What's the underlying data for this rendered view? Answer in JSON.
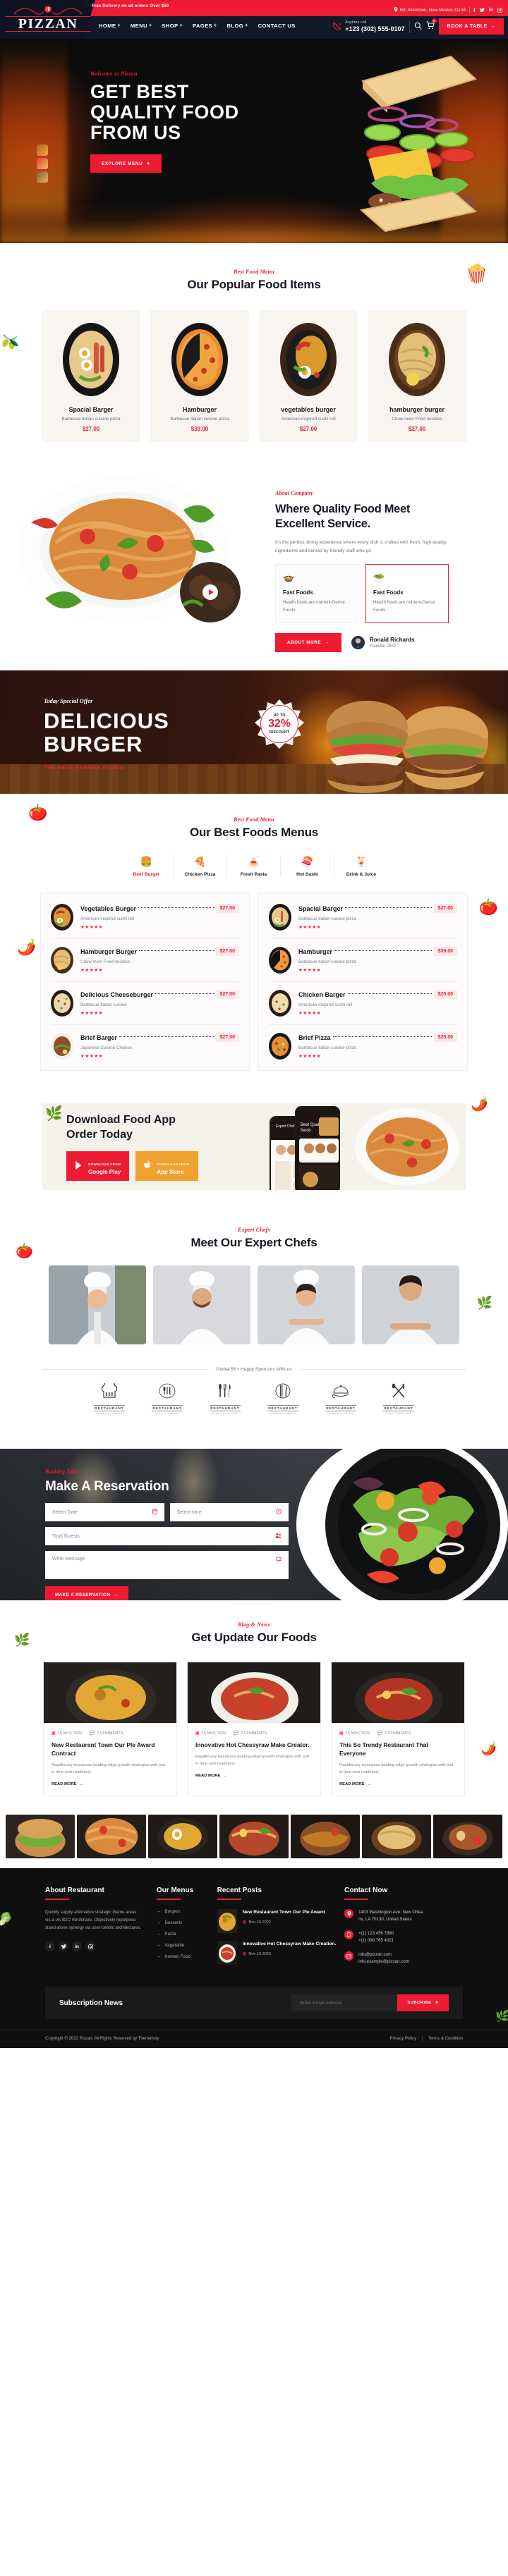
{
  "header": {
    "topbar_promo": "Free Delivery on all orders Over $50",
    "address": "Rd. Allentown, New Mexico 31134",
    "address_icon": "location-pin-icon",
    "socials": [
      "facebook-icon",
      "twitter-icon",
      "linkedin-icon",
      "instagram-icon"
    ],
    "logo_text": "PIZZAN",
    "nav": [
      {
        "label": "HOME",
        "has_dropdown": true
      },
      {
        "label": "MENU",
        "has_dropdown": true
      },
      {
        "label": "SHOP",
        "has_dropdown": true
      },
      {
        "label": "PAGES",
        "has_dropdown": true
      },
      {
        "label": "BLOG",
        "has_dropdown": true
      },
      {
        "label": "CONTACT US",
        "has_dropdown": false
      }
    ],
    "call_label": "Anytime call",
    "phone": "+123 (302) 555-0107",
    "cart_count": "0",
    "book_button": "BOOK A TABLE"
  },
  "hero": {
    "eyebrow": "Welcome to Pizzan",
    "title_lines": [
      "GET BEST",
      "QUALITY FOOD",
      "FROM US"
    ],
    "cta": "EXPLORE MENU"
  },
  "popular": {
    "label": "Best Food Menu",
    "title": "Our Popular Food Items",
    "items": [
      {
        "name": "Spacial Barger",
        "desc": "Barbecue Italian cuisine pizza",
        "price": "$27.00"
      },
      {
        "name": "Hamburger",
        "desc": "Barbecue Italian cuisine pizza",
        "price": "$39.00"
      },
      {
        "name": "vegetables burger",
        "desc": "American-inspired sushi roll",
        "price": "$27.00"
      },
      {
        "name": "hamburger burger",
        "desc": "Chow mien Fried noodles",
        "price": "$27.00"
      }
    ]
  },
  "about": {
    "label": "About Company",
    "title_lines": [
      "Where Quality Food Meet",
      "Excellent Service."
    ],
    "text": "It's the perfect dining experience where every dish is crafted with fresh, high-quality ingredients and served by friendly staff who go",
    "cards": [
      {
        "icon": "bowl-food-icon",
        "name": "Fast Foods",
        "desc": "Health foods are nutrient-Dense Foods"
      },
      {
        "icon": "plate-cutlery-icon",
        "name": "Fast Foods",
        "desc": "Health foods are nutrient-Dense Foods"
      }
    ],
    "button": "ABOUT MORE",
    "founder_name": "Ronald Richards",
    "founder_role": "Founder CEO",
    "play_icon": "play-icon"
  },
  "offer": {
    "eyebrow": "Today Special Offer",
    "title_lines": [
      "DELICIOUS",
      "BURGER"
    ],
    "note": "THE BEST BURGER PIZZAN",
    "badge_up": "UP TO",
    "badge_value": "32%",
    "badge_down": "DISCOUNT"
  },
  "menus": {
    "label": "Best Food Menu",
    "title": "Our Best Foods Menus",
    "tabs": [
      {
        "label": "Beef Burger",
        "icon": "burger-icon",
        "active": true
      },
      {
        "label": "Chicken Pizza",
        "icon": "pizza-icon",
        "active": false
      },
      {
        "label": "Fresh Pasta",
        "icon": "pasta-icon",
        "active": false
      },
      {
        "label": "Hot Sushi",
        "icon": "sushi-icon",
        "active": false
      },
      {
        "label": "Drink & Juice",
        "icon": "drink-icon",
        "active": false
      }
    ],
    "left_items": [
      {
        "name": "Vegetables Burger",
        "desc": "American-inspired sushi roll",
        "price": "$27.00",
        "stars": "★★★★★"
      },
      {
        "name": "Hamburger Burger",
        "desc": "Chow mien Fried noodles",
        "price": "$27.00",
        "stars": "★★★★★"
      },
      {
        "name": "Delicious Cheeseburger",
        "desc": "Barbecue Italian cuisine",
        "price": "$27.00",
        "stars": "★★★★★"
      },
      {
        "name": "Brief Barger",
        "desc": "Japanese Cuisine Chicken",
        "price": "$27.00",
        "stars": "★★★★★"
      }
    ],
    "right_items": [
      {
        "name": "Spacial Barger",
        "desc": "Barbecue Italian cuisine pizza",
        "price": "$27.00",
        "stars": "★★★★★"
      },
      {
        "name": "Hamburger",
        "desc": "Barbecue Italian cuisine pizza",
        "price": "$39.00",
        "stars": "★★★★★"
      },
      {
        "name": "Chicken Barger",
        "desc": "American-inspired sushi roll",
        "price": "$25.00",
        "stars": "★★★★★"
      },
      {
        "name": "Brief Pizza",
        "desc": "Barbecue Italian cuisine pizza",
        "price": "$25.00",
        "stars": "★★★★★"
      }
    ]
  },
  "app": {
    "title_lines": [
      "Download Food App",
      "Order Today"
    ],
    "google": {
      "small": "DOWNLOAD FROM",
      "big": "Google Play",
      "icon": "google-play-icon"
    },
    "apple": {
      "small": "DOWNLOAD FROM",
      "big": "App Store",
      "icon": "apple-icon"
    }
  },
  "chefs": {
    "label": "Expert Chefs",
    "title": "Meet Our Expert Chefs",
    "sponsors_text": "Global 5K+ Happy Sponsors With us",
    "sponsor_logos": [
      {
        "mark": "chef-hat-icon",
        "word": "RESTAURANT",
        "sub": "SANDWICH COMPANY"
      },
      {
        "mark": "cutlery-badge-icon",
        "word": "RESTAURANT",
        "sub": "QUALITY & BRAND"
      },
      {
        "mark": "fork-knife-spoon-icon",
        "word": "RESTAURANT",
        "sub": "FAMILY SINCE 1992"
      },
      {
        "mark": "fork-plate-icon",
        "word": "RESTAURANT",
        "sub": "SANDWICH COMPANY"
      },
      {
        "mark": "serving-tray-icon",
        "word": "RESTAURANT",
        "sub": "SANDWICH COMPANY"
      },
      {
        "mark": "spoon-fork-cross-icon",
        "word": "RESTAURANT",
        "sub": "FAMILY SINCE 1992"
      }
    ]
  },
  "reservation": {
    "label": "Booking Table",
    "title": "Make A Reservation",
    "fields": [
      {
        "placeholder": "Select Date",
        "icon": "calendar-icon"
      },
      {
        "placeholder": "Select-time",
        "icon": "clock-icon"
      },
      {
        "placeholder": "Total Guests",
        "icon": "users-icon"
      },
      {
        "placeholder": "Write Message",
        "icon": "comment-icon"
      }
    ],
    "button": "MAKE A RESERVATION"
  },
  "blog": {
    "label": "Blog & News",
    "title": "Get Update Our Foods",
    "posts": [
      {
        "date": "16 NOV, 2022",
        "comments": "2 COMMENTS",
        "title": "New Restaurant Town Our Ple Award Contract",
        "text": "Rapidiously repurpose leading-edge growth strategies with just in time web readiness",
        "more": "READ MORE"
      },
      {
        "date": "16 NOV, 2022",
        "comments": "2 COMMENTS",
        "title": "Innovative Hot Chessyraw Make Creator.",
        "text": "Rapidiously repurpose leading-edge growth strategies with just in time web readiness",
        "more": "READ MORE"
      },
      {
        "date": "16 NOV, 2022",
        "comments": "2 COMMENTS",
        "title": "This So Trendy Restaurant That Everyone",
        "text": "Rapidiously repurpose leading-edge growth strategies with just in time web readiness",
        "more": "READ MORE"
      }
    ]
  },
  "footer": {
    "about_title": "About Restaurant",
    "about_text": "Quickly supply alternative strategic theme areas vis-a-vis B2C mindshare. Objectively repurpose stand-alone synergy via user-centric architectures.",
    "socials": [
      "facebook-icon",
      "twitter-icon",
      "linkedin-icon",
      "instagram-icon"
    ],
    "menus_title": "Our Menus",
    "menus": [
      "Burgers",
      "Desserts",
      "Pasta",
      "Vagetable",
      "Korean Food"
    ],
    "posts_title": "Recent Posts",
    "posts": [
      {
        "title": "New Restaurant Town Our Ple Award",
        "date": "Nov 16 2022"
      },
      {
        "title": "Innovative Hot Chessyraw Make Creation.",
        "date": "Nov 16 2022"
      }
    ],
    "contact_title": "Contact Now",
    "contact": [
      {
        "icon": "location-pin-icon",
        "lines": [
          "1403 Washington Ave, New Orlea",
          "ns, LA 70130, United States"
        ]
      },
      {
        "icon": "phone-icon",
        "lines": [
          "+(1) 123 456 7890",
          "+(1) 098 765 4321"
        ]
      },
      {
        "icon": "envelope-icon",
        "lines": [
          "info@pizzan.com",
          "info.example@pizzan.com"
        ]
      }
    ],
    "subscription_title": "Subscription News",
    "subscription_placeholder": "Enter Email Address",
    "subscribe_button": "SUBCRIBE",
    "copyright": "Copyright © 2022 Pizzan. All Rights Reserved by Themeholy",
    "privacy": "Privacy Policy",
    "terms": "Terms & Condition"
  }
}
